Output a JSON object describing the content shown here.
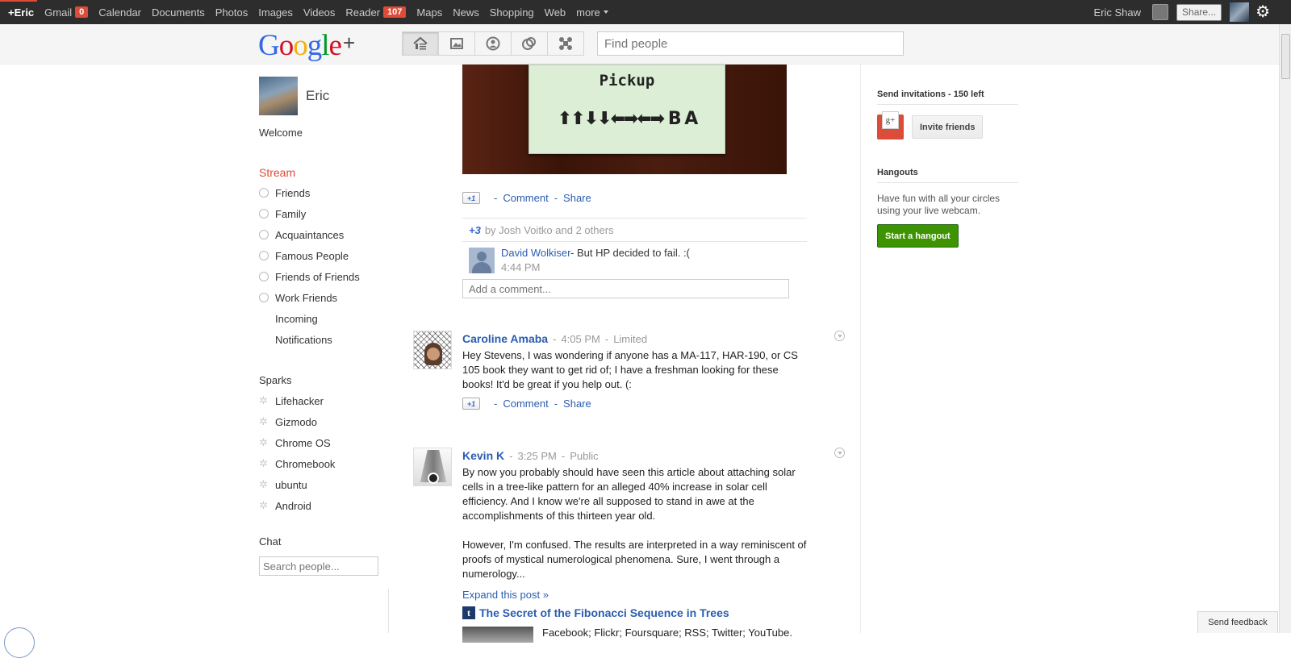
{
  "gbar": {
    "items": [
      {
        "label": "+Eric"
      },
      {
        "label": "Gmail",
        "badge": "0"
      },
      {
        "label": "Calendar"
      },
      {
        "label": "Documents"
      },
      {
        "label": "Photos"
      },
      {
        "label": "Images"
      },
      {
        "label": "Videos"
      },
      {
        "label": "Reader",
        "badge": "107"
      },
      {
        "label": "Maps"
      },
      {
        "label": "News"
      },
      {
        "label": "Shopping"
      },
      {
        "label": "Web"
      },
      {
        "label": "more"
      }
    ],
    "user_name": "Eric Shaw",
    "share_label": "Share...",
    "accent": "#dd4b39"
  },
  "header": {
    "logo": {
      "G": "G",
      "o1": "o",
      "o2": "o",
      "g": "g",
      "l": "l",
      "e": "e",
      "plus": "+"
    },
    "nav_icons": [
      "home-icon",
      "photos-icon",
      "profile-icon",
      "circles-icon",
      "games-icon"
    ],
    "search_placeholder": "Find people"
  },
  "sidebar": {
    "name": "Eric",
    "welcome": "Welcome",
    "stream_title": "Stream",
    "circles": [
      "Friends",
      "Family",
      "Acquaintances",
      "Famous People",
      "Friends of Friends",
      "Work Friends"
    ],
    "incoming": "Incoming",
    "notifications": "Notifications",
    "sparks_title": "Sparks",
    "sparks": [
      "Lifehacker",
      "Gizmodo",
      "Chrome OS",
      "Chromebook",
      "ubuntu",
      "Android"
    ],
    "chat_title": "Chat",
    "chat_placeholder": "Search people..."
  },
  "stream": {
    "image": {
      "title": "Pickup",
      "arrows": "⬆⬆⬇⬇⬅➡⬅➡ B A"
    },
    "actions": {
      "plusone": "+1",
      "sep": "-",
      "comment": "Comment",
      "share": "Share"
    },
    "plus_count": "+3",
    "plus_text": "by Josh Voitko and 2 others",
    "comment": {
      "author": "David Wolkiser",
      "text": "- But HP decided to fail. :(",
      "time": "4:44 PM"
    },
    "add_comment_placeholder": "Add a comment...",
    "posts": [
      {
        "author": "Caroline Amaba",
        "time": "4:05 PM",
        "visibility": "Limited",
        "body": "Hey Stevens, I was wondering if anyone has a MA-117, HAR-190, or CS 105 book they want to get rid of; I have a freshman looking for these books! It'd be great if you help out. (:"
      },
      {
        "author": "Kevin K",
        "time": "3:25 PM",
        "visibility": "Public",
        "body1": "By now you probably should have seen this article about attaching solar cells in a tree-like pattern for an alleged 40% increase in solar cell efficiency. And I know we're all supposed to stand in awe at the accomplishments of this thirteen year old.",
        "body2": "However, I'm confused. The results are interpreted in a way reminiscent of proofs of mystical numerological phenomena. Sure, I went through a numerology...",
        "expand": "Expand this post »",
        "link_icon": "t",
        "link_title": "The Secret of the Fibonacci Sequence in Trees",
        "link_snippet": "Facebook; Flickr; Foursquare; RSS; Twitter; YouTube."
      }
    ]
  },
  "right": {
    "invite_title": "Send invitations - 150 left",
    "invite_card": "g+",
    "invite_button": "Invite friends",
    "hangouts_title": "Hangouts",
    "hangouts_text": "Have fun with all your circles using your live webcam.",
    "hangout_button": "Start a hangout"
  },
  "feedback": "Send feedback",
  "colors": {
    "link": "#2a5db0",
    "stream_red": "#dd4b39",
    "hangout_green": "#3d9400"
  }
}
